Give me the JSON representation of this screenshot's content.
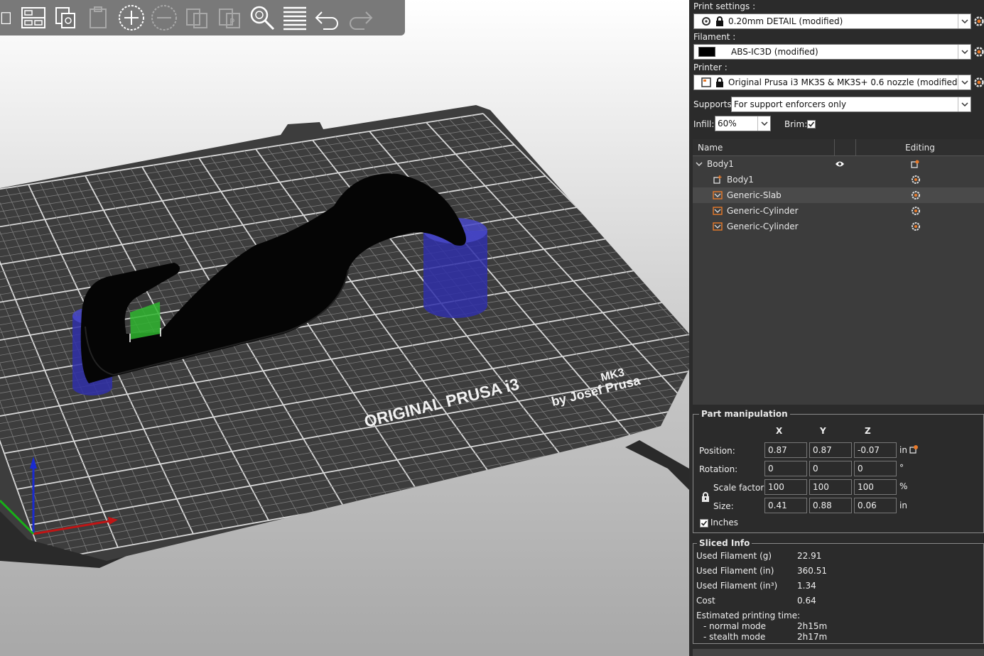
{
  "toolbar": {
    "buttons": [
      {
        "name": "delete-all-icon",
        "enabled": true
      },
      {
        "name": "arrange-icon",
        "enabled": true
      },
      {
        "name": "copy-icon",
        "enabled": true
      },
      {
        "name": "paste-icon",
        "enabled": false
      },
      {
        "name": "add-instance-icon",
        "enabled": true
      },
      {
        "name": "remove-instance-icon",
        "enabled": false
      },
      {
        "name": "split-objects-icon",
        "enabled": false
      },
      {
        "name": "split-parts-icon",
        "enabled": false
      },
      {
        "name": "search-icon",
        "enabled": true
      },
      {
        "name": "layers-editing-icon",
        "enabled": true
      },
      {
        "name": "undo-icon",
        "enabled": true
      },
      {
        "name": "redo-icon",
        "enabled": false
      }
    ]
  },
  "bed": {
    "brand_line1": "ORIGINAL PRUSA i3",
    "brand_model": "MK3",
    "brand_line2": "by Josef Prusa"
  },
  "sidebar": {
    "print_settings_label": "Print settings :",
    "print_settings_value": "0.20mm DETAIL (modified)",
    "filament_label": "Filament :",
    "filament_value": "ABS-IC3D (modified)",
    "filament_color": "#000000",
    "printer_label": "Printer :",
    "printer_value": "Original Prusa i3 MK3S & MK3S+ 0.6 nozzle (modified)",
    "supports_label": "Supports:",
    "supports_value": "For support enforcers only",
    "infill_label": "Infill:",
    "infill_value": "60%",
    "brim_label": "Brim:",
    "brim_checked": true
  },
  "object_list": {
    "col_name": "Name",
    "col_editing": "Editing",
    "rows": [
      {
        "label": "Body1",
        "type": "object",
        "selected": false
      },
      {
        "label": "Body1",
        "type": "part",
        "selected": false
      },
      {
        "label": "Generic-Slab",
        "type": "enforcer",
        "selected": true
      },
      {
        "label": "Generic-Cylinder",
        "type": "enforcer",
        "selected": false
      },
      {
        "label": "Generic-Cylinder",
        "type": "enforcer",
        "selected": false
      }
    ]
  },
  "part_manipulation": {
    "title": "Part manipulation",
    "x_label": "X",
    "y_label": "Y",
    "z_label": "Z",
    "position_label": "Position:",
    "position": [
      "0.87",
      "0.87",
      "-0.07"
    ],
    "position_unit": "in",
    "rotation_label": "Rotation:",
    "rotation": [
      "0",
      "0",
      "0"
    ],
    "rotation_unit": "°",
    "scale_label": "Scale factors:",
    "scale": [
      "100",
      "100",
      "100"
    ],
    "scale_unit": "%",
    "size_label": "Size:",
    "size": [
      "0.41",
      "0.88",
      "0.06"
    ],
    "size_unit": "in",
    "inches_label": "Inches",
    "inches_checked": true
  },
  "sliced_info": {
    "title": "Sliced Info",
    "rows": [
      {
        "label": "Used Filament (g)",
        "value": "22.91"
      },
      {
        "label": "Used Filament (in)",
        "value": "360.51"
      },
      {
        "label": "Used Filament (in³)",
        "value": "1.34"
      },
      {
        "label": "Cost",
        "value": "0.64"
      }
    ],
    "time_label": "Estimated printing time:",
    "normal_label": "- normal mode",
    "normal_value": "2h15m",
    "stealth_label": "- stealth mode",
    "stealth_value": "2h17m"
  },
  "colors": {
    "accent": "#ed6b21",
    "enforcer": "#3a3acc",
    "slab": "#2fb52f",
    "bed": "#3a3a3a"
  }
}
